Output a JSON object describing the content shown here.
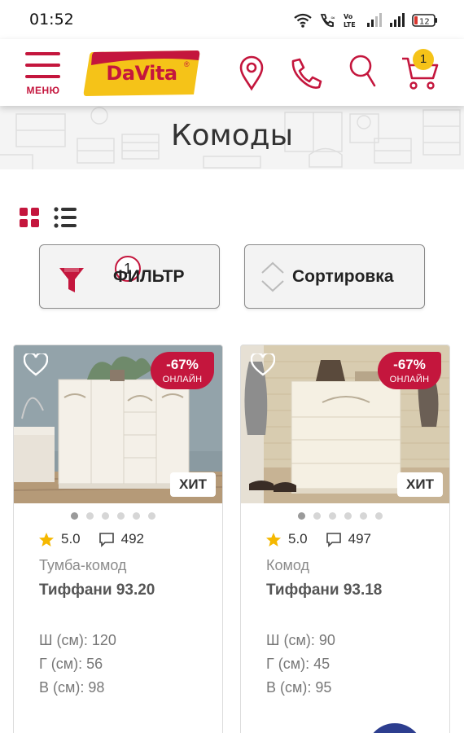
{
  "status": {
    "time": "01:52",
    "battery": "12"
  },
  "header": {
    "menu_label": "МЕНЮ",
    "logo_text": "DaVita",
    "logo_mark": "®",
    "cart_count": "1",
    "icons": [
      "location-pin-icon",
      "phone-icon",
      "search-icon",
      "cart-icon"
    ]
  },
  "page": {
    "title": "Комоды"
  },
  "toolbar": {
    "filter_label": "ФИЛЬТР",
    "filter_count": "1",
    "sort_label": "Сортировка"
  },
  "colors": {
    "brand": "#c4163d",
    "logo_yellow": "#f5c318",
    "badge_yellow": "#f5c318"
  },
  "products": [
    {
      "discount": "-67%",
      "discount_note": "ОНЛАЙН",
      "badge": "ХИТ",
      "rating": "5.0",
      "reviews": "492",
      "category": "Тумба-комод",
      "name": "Тиффани 93.20",
      "width": "Ш (см): 120",
      "depth": "Г (см): 56",
      "height": "В (см): 98",
      "image_slides": 6,
      "active_slide": 1
    },
    {
      "discount": "-67%",
      "discount_note": "ОНЛАЙН",
      "badge": "ХИТ",
      "rating": "5.0",
      "reviews": "497",
      "category": "Комод",
      "name": "Тиффани 93.18",
      "width": "Ш (см): 90",
      "depth": "Г (см): 45",
      "height": "В (см): 95",
      "image_slides": 6,
      "active_slide": 1
    }
  ]
}
